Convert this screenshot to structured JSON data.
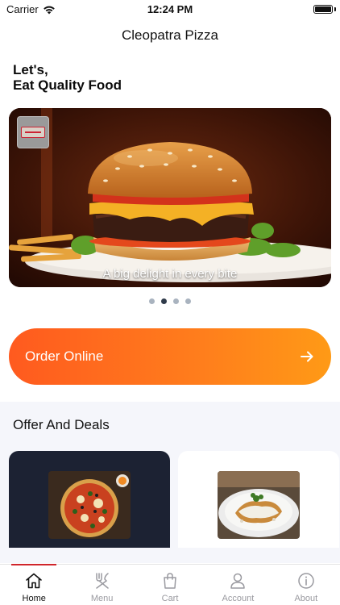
{
  "status": {
    "carrier": "Carrier",
    "time": "12:24 PM"
  },
  "header": {
    "title": "Cleopatra Pizza"
  },
  "greeting": {
    "line1": "Let's,",
    "line2": "Eat Quality Food"
  },
  "banner": {
    "caption": "A big delight in every bite",
    "slide_count": 4,
    "active_index": 1
  },
  "order": {
    "label": "Order Online",
    "icon": "arrow-right-icon"
  },
  "deals": {
    "title": "Offer And Deals"
  },
  "tabs": [
    {
      "label": "Home",
      "icon": "home-icon",
      "active": true
    },
    {
      "label": "Menu",
      "icon": "utensils-icon",
      "active": false
    },
    {
      "label": "Cart",
      "icon": "shopping-bag-icon",
      "active": false
    },
    {
      "label": "Account",
      "icon": "user-icon",
      "active": false
    },
    {
      "label": "About",
      "icon": "info-icon",
      "active": false
    }
  ],
  "colors": {
    "accent": "#d0252b",
    "order_start": "#ff5a1f",
    "order_end": "#ff9a16",
    "deal_card_dark": "#1c2233",
    "deals_background": "#f5f6fb"
  }
}
